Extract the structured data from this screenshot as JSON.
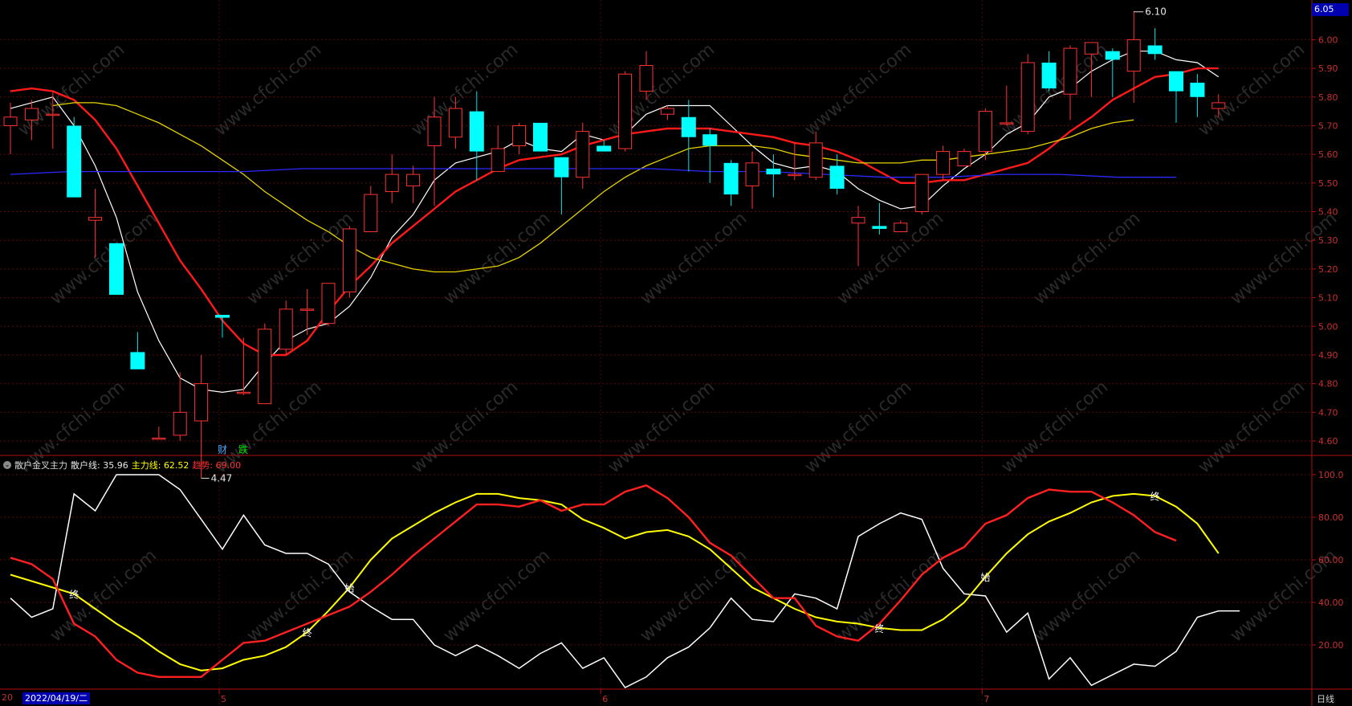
{
  "chart_data": {
    "type": "candlestick",
    "timeframe_label": "日线",
    "selected_date": "2022/04/19/二",
    "price_axis_ticks": [
      6.0,
      5.9,
      5.8,
      5.7,
      5.6,
      5.5,
      5.4,
      5.3,
      5.2,
      5.1,
      5.0,
      4.9,
      4.8,
      4.7,
      4.6
    ],
    "price_axis_range": [
      4.45,
      6.1
    ],
    "current_price_label": "6.05",
    "high_marker": "6.10",
    "low_marker": "4.47",
    "event_tags": [
      "财",
      "跌"
    ],
    "month_labels": [
      "5",
      "6",
      "7"
    ],
    "left_cut_label": "20",
    "candles": [
      {
        "o": 5.7,
        "h": 5.78,
        "l": 5.6,
        "c": 5.73,
        "up": true
      },
      {
        "o": 5.72,
        "h": 5.79,
        "l": 5.65,
        "c": 5.76,
        "up": true
      },
      {
        "o": 5.74,
        "h": 5.82,
        "l": 5.62,
        "c": 5.74,
        "up": true
      },
      {
        "o": 5.7,
        "h": 5.73,
        "l": 5.45,
        "c": 5.45,
        "up": false
      },
      {
        "o": 5.37,
        "h": 5.48,
        "l": 5.24,
        "c": 5.38,
        "up": true
      },
      {
        "o": 5.29,
        "h": 5.29,
        "l": 5.11,
        "c": 5.11,
        "up": false
      },
      {
        "o": 4.91,
        "h": 4.98,
        "l": 4.85,
        "c": 4.85,
        "up": false
      },
      {
        "o": 4.61,
        "h": 4.65,
        "l": 4.61,
        "c": 4.61,
        "up": true
      },
      {
        "o": 4.62,
        "h": 4.84,
        "l": 4.6,
        "c": 4.7,
        "up": true
      },
      {
        "o": 4.67,
        "h": 4.9,
        "l": 4.47,
        "c": 4.8,
        "up": true
      },
      {
        "o": 5.04,
        "h": 5.04,
        "l": 4.96,
        "c": 5.03,
        "up": false
      },
      {
        "o": 4.77,
        "h": 4.96,
        "l": 4.76,
        "c": 4.77,
        "up": true
      },
      {
        "o": 4.73,
        "h": 5.01,
        "l": 4.73,
        "c": 4.99,
        "up": true
      },
      {
        "o": 4.92,
        "h": 5.09,
        "l": 4.9,
        "c": 5.06,
        "up": true
      },
      {
        "o": 5.06,
        "h": 5.13,
        "l": 4.97,
        "c": 5.06,
        "up": true
      },
      {
        "o": 5.01,
        "h": 5.15,
        "l": 5.0,
        "c": 5.15,
        "up": true
      },
      {
        "o": 5.12,
        "h": 5.35,
        "l": 5.1,
        "c": 5.34,
        "up": true
      },
      {
        "o": 5.33,
        "h": 5.49,
        "l": 5.33,
        "c": 5.46,
        "up": true
      },
      {
        "o": 5.47,
        "h": 5.6,
        "l": 5.43,
        "c": 5.53,
        "up": true
      },
      {
        "o": 5.49,
        "h": 5.56,
        "l": 5.43,
        "c": 5.53,
        "up": true
      },
      {
        "o": 5.63,
        "h": 5.8,
        "l": 5.42,
        "c": 5.73,
        "up": true
      },
      {
        "o": 5.66,
        "h": 5.8,
        "l": 5.62,
        "c": 5.76,
        "up": true
      },
      {
        "o": 5.75,
        "h": 5.82,
        "l": 5.51,
        "c": 5.61,
        "up": false
      },
      {
        "o": 5.54,
        "h": 5.7,
        "l": 5.54,
        "c": 5.62,
        "up": true
      },
      {
        "o": 5.63,
        "h": 5.71,
        "l": 5.6,
        "c": 5.7,
        "up": true
      },
      {
        "o": 5.71,
        "h": 5.71,
        "l": 5.61,
        "c": 5.61,
        "up": false
      },
      {
        "o": 5.59,
        "h": 5.59,
        "l": 5.39,
        "c": 5.52,
        "up": false
      },
      {
        "o": 5.52,
        "h": 5.71,
        "l": 5.48,
        "c": 5.68,
        "up": true
      },
      {
        "o": 5.63,
        "h": 5.65,
        "l": 5.61,
        "c": 5.61,
        "up": false
      },
      {
        "o": 5.62,
        "h": 5.89,
        "l": 5.61,
        "c": 5.88,
        "up": true
      },
      {
        "o": 5.82,
        "h": 5.96,
        "l": 5.79,
        "c": 5.91,
        "up": true
      },
      {
        "o": 5.74,
        "h": 5.77,
        "l": 5.72,
        "c": 5.76,
        "up": true
      },
      {
        "o": 5.73,
        "h": 5.79,
        "l": 5.54,
        "c": 5.66,
        "up": false
      },
      {
        "o": 5.67,
        "h": 5.69,
        "l": 5.5,
        "c": 5.63,
        "up": false
      },
      {
        "o": 5.57,
        "h": 5.58,
        "l": 5.42,
        "c": 5.46,
        "up": false
      },
      {
        "o": 5.49,
        "h": 5.61,
        "l": 5.41,
        "c": 5.57,
        "up": true
      },
      {
        "o": 5.55,
        "h": 5.6,
        "l": 5.45,
        "c": 5.53,
        "up": false
      },
      {
        "o": 5.53,
        "h": 5.64,
        "l": 5.51,
        "c": 5.53,
        "up": true
      },
      {
        "o": 5.52,
        "h": 5.68,
        "l": 5.51,
        "c": 5.64,
        "up": true
      },
      {
        "o": 5.56,
        "h": 5.6,
        "l": 5.46,
        "c": 5.48,
        "up": false
      },
      {
        "o": 5.36,
        "h": 5.42,
        "l": 5.21,
        "c": 5.38,
        "up": true
      },
      {
        "o": 5.35,
        "h": 5.43,
        "l": 5.32,
        "c": 5.34,
        "up": false
      },
      {
        "o": 5.33,
        "h": 5.37,
        "l": 5.33,
        "c": 5.36,
        "up": true
      },
      {
        "o": 5.4,
        "h": 5.53,
        "l": 5.39,
        "c": 5.53,
        "up": true
      },
      {
        "o": 5.53,
        "h": 5.63,
        "l": 5.51,
        "c": 5.61,
        "up": true
      },
      {
        "o": 5.56,
        "h": 5.62,
        "l": 5.56,
        "c": 5.61,
        "up": true
      },
      {
        "o": 5.61,
        "h": 5.76,
        "l": 5.58,
        "c": 5.75,
        "up": true
      },
      {
        "o": 5.71,
        "h": 5.84,
        "l": 5.7,
        "c": 5.71,
        "up": true
      },
      {
        "o": 5.68,
        "h": 5.95,
        "l": 5.67,
        "c": 5.92,
        "up": true
      },
      {
        "o": 5.92,
        "h": 5.96,
        "l": 5.82,
        "c": 5.83,
        "up": false
      },
      {
        "o": 5.81,
        "h": 5.98,
        "l": 5.72,
        "c": 5.97,
        "up": true
      },
      {
        "o": 5.99,
        "h": 5.99,
        "l": 5.8,
        "c": 5.95,
        "up": true
      },
      {
        "o": 5.96,
        "h": 5.97,
        "l": 5.8,
        "c": 5.93,
        "up": false
      },
      {
        "o": 5.89,
        "h": 6.1,
        "l": 5.78,
        "c": 6.0,
        "up": true
      },
      {
        "o": 5.98,
        "h": 6.04,
        "l": 5.93,
        "c": 5.95,
        "up": false
      },
      {
        "o": 5.89,
        "h": 5.89,
        "l": 5.71,
        "c": 5.82,
        "up": false
      },
      {
        "o": 5.85,
        "h": 5.88,
        "l": 5.73,
        "c": 5.8,
        "up": false
      },
      {
        "o": 5.76,
        "h": 5.81,
        "l": 5.73,
        "c": 5.78,
        "up": true
      }
    ],
    "price_lines": [
      {
        "name": "MA5",
        "color": "#ffffff",
        "values": [
          5.76,
          5.78,
          5.8,
          5.7,
          5.56,
          5.38,
          5.12,
          4.95,
          4.82,
          4.78,
          4.77,
          4.78,
          4.87,
          4.95,
          4.99,
          5.01,
          5.07,
          5.17,
          5.31,
          5.39,
          5.51,
          5.57,
          5.59,
          5.61,
          5.65,
          5.62,
          5.61,
          5.67,
          5.65,
          5.67,
          5.74,
          5.77,
          5.77,
          5.77,
          5.7,
          5.63,
          5.57,
          5.55,
          5.56,
          5.54,
          5.48,
          5.44,
          5.41,
          5.42,
          5.49,
          5.55,
          5.6,
          5.67,
          5.71,
          5.8,
          5.83,
          5.89,
          5.93,
          5.96,
          5.96,
          5.93,
          5.92,
          5.87
        ]
      },
      {
        "name": "MA10",
        "color": "#ff1a1a",
        "values": [
          5.82,
          5.83,
          5.82,
          5.79,
          5.72,
          5.62,
          5.49,
          5.36,
          5.23,
          5.13,
          5.02,
          4.94,
          4.9,
          4.9,
          4.95,
          5.05,
          5.14,
          5.21,
          5.29,
          5.35,
          5.41,
          5.47,
          5.51,
          5.55,
          5.58,
          5.59,
          5.6,
          5.63,
          5.65,
          5.67,
          5.68,
          5.69,
          5.69,
          5.69,
          5.68,
          5.67,
          5.66,
          5.64,
          5.63,
          5.61,
          5.58,
          5.54,
          5.5,
          5.5,
          5.51,
          5.51,
          5.53,
          5.55,
          5.57,
          5.62,
          5.68,
          5.73,
          5.79,
          5.83,
          5.87,
          5.88,
          5.9,
          5.9
        ]
      },
      {
        "name": "MA20",
        "color": "#e6d200",
        "values": [
          5.77,
          5.78,
          5.78,
          5.77,
          5.74,
          5.71,
          5.67,
          5.63,
          5.58,
          5.53,
          5.47,
          5.42,
          5.37,
          5.33,
          5.28,
          5.24,
          5.22,
          5.2,
          5.19,
          5.19,
          5.2,
          5.21,
          5.24,
          5.29,
          5.35,
          5.41,
          5.47,
          5.52,
          5.56,
          5.59,
          5.62,
          5.63,
          5.63,
          5.63,
          5.62,
          5.6,
          5.59,
          5.58,
          5.57,
          5.57,
          5.57,
          5.58,
          5.58,
          5.59,
          5.6,
          5.61,
          5.62,
          5.64,
          5.66,
          5.69,
          5.71,
          5.72
        ]
      },
      {
        "name": "MA60",
        "color": "#2a2aff",
        "values": [
          5.53,
          5.54,
          5.54,
          5.54,
          5.54,
          5.55,
          5.55,
          5.55,
          5.55,
          5.55,
          5.55,
          5.55,
          5.54,
          5.54,
          5.53,
          5.52,
          5.52,
          5.53,
          5.53,
          5.52,
          5.52
        ]
      }
    ],
    "indicator": {
      "name": "散户金叉主力",
      "lines": [
        {
          "name": "散户线",
          "label": "散户线:",
          "value": "35.96",
          "color": "#ffffff"
        },
        {
          "name": "主力线",
          "label": "主力线:",
          "value": "62.52",
          "color": "#ffff00"
        },
        {
          "name": "趋势",
          "label": "趋势:",
          "value": "69.00",
          "color": "#ff2020"
        }
      ],
      "y_ticks": [
        100.0,
        80.0,
        60.0,
        40.0,
        20.0
      ],
      "y_tick_labels": [
        "100.0",
        "80.00",
        "60.00",
        "40.00",
        "20.00"
      ],
      "retail": [
        42,
        33,
        37,
        91,
        83,
        100,
        100,
        100,
        93,
        79,
        65,
        81,
        67,
        63,
        63,
        58,
        45,
        38,
        32,
        32,
        20,
        15,
        20,
        15,
        9,
        16,
        21,
        9,
        14,
        0,
        5,
        14,
        19,
        28,
        42,
        32,
        31,
        44,
        42,
        37,
        71,
        77,
        82,
        79,
        56,
        44,
        43,
        26,
        35,
        4,
        14,
        1,
        6,
        11,
        10,
        17,
        33,
        36,
        36
      ],
      "main": [
        53,
        50,
        47,
        44,
        37,
        30,
        24,
        17,
        11,
        8,
        9,
        13,
        15,
        19,
        26,
        36,
        47,
        60,
        70,
        76,
        82,
        87,
        91,
        91,
        89,
        88,
        86,
        79,
        75,
        70,
        73,
        74,
        71,
        65,
        56,
        47,
        42,
        37,
        33,
        31,
        30,
        28,
        27,
        27,
        32,
        40,
        52,
        63,
        72,
        78,
        82,
        87,
        90,
        91,
        90,
        85,
        77,
        63
      ],
      "trend": [
        61,
        58,
        51,
        30,
        24,
        13,
        7,
        5,
        5,
        5,
        13,
        21,
        22,
        26,
        30,
        34,
        38,
        45,
        53,
        62,
        70,
        78,
        86,
        86,
        85,
        88,
        83,
        86,
        86,
        92,
        95,
        89,
        80,
        68,
        62,
        52,
        42,
        42,
        29,
        24,
        22,
        30,
        41,
        53,
        61,
        66,
        77,
        81,
        89,
        93,
        92,
        92,
        87,
        81,
        73,
        69
      ],
      "signal_marks": [
        {
          "text": "终",
          "idx": 3,
          "line": "main"
        },
        {
          "text": "终",
          "idx": 14,
          "line": "main"
        },
        {
          "text": "始",
          "idx": 16,
          "line": "main"
        },
        {
          "text": "终",
          "idx": 41,
          "line": "main"
        },
        {
          "text": "始",
          "idx": 46,
          "line": "main"
        },
        {
          "text": "终",
          "idx": 54,
          "line": "main"
        }
      ]
    },
    "watermark": "www.cfchi.com"
  }
}
